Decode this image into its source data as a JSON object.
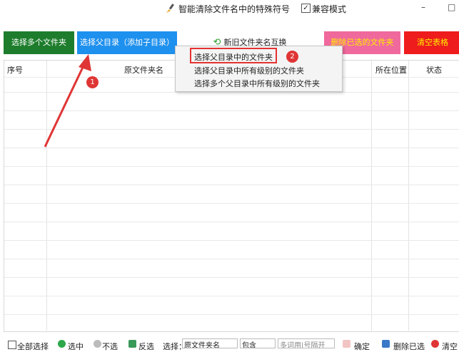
{
  "titlebar": {
    "title": "智能清除文件名中的特殊符号",
    "icon": "brush-icon",
    "compat_mode": {
      "label": "兼容模式",
      "checked": true
    },
    "minimize": "–",
    "maximize": "□"
  },
  "toolbar": {
    "select_multi": "选择多个文件夹",
    "select_parent": "选择父目录（添加子目录）",
    "swap": "新旧文件夹名互换",
    "delete_selected": "删除已选的文件夹",
    "clear_table": "清空表格"
  },
  "table": {
    "columns": [
      "序号",
      "原文件夹名",
      "所在位置",
      "状态"
    ]
  },
  "menu": {
    "items": [
      "选择父目录中的文件夹",
      "选择父目录中所有级别的文件夹",
      "选择多个父目录中所有级别的文件夹"
    ]
  },
  "annotations": {
    "badge1": "1",
    "badge2": "2"
  },
  "colors": {
    "green": "#1d7d2c",
    "blue": "#1e90ee",
    "pink": "#f0699c",
    "red": "#ee1c1c",
    "annotation": "#e03535"
  },
  "bottom": {
    "select_all": "全部选择",
    "select": "选中",
    "deselect": "不选",
    "invert": "反选",
    "filter_label": "选择：",
    "filter_field": "原文件夹名",
    "filter_mode": "包含",
    "filter_placeholder": "多词用|号隔开",
    "confirm": "确定",
    "delete_selected": "删除已选",
    "clear": "清空"
  }
}
